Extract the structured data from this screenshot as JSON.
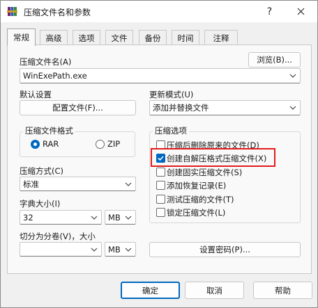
{
  "window": {
    "title": "压缩文件名和参数",
    "help_glyph": "?",
    "close_glyph": "✕"
  },
  "tabs": [
    "常规",
    "高级",
    "选项",
    "文件",
    "备份",
    "时间",
    "注释"
  ],
  "archive_name": {
    "label": "压缩文件名(A)",
    "value": "WinExePath.exe",
    "browse_label": "浏览(B)..."
  },
  "default_settings": {
    "label": "默认设置",
    "profiles_button": "配置文件(F)..."
  },
  "update_mode": {
    "label": "更新模式(U)",
    "value": "添加并替换文件"
  },
  "archive_format": {
    "label": "压缩文件格式",
    "options": [
      "RAR",
      "ZIP"
    ],
    "selected": "RAR"
  },
  "compression_method": {
    "label": "压缩方式(C)",
    "value": "标准"
  },
  "dictionary_size": {
    "label": "字典大小(I)",
    "value": "32",
    "unit": "MB"
  },
  "split_volumes": {
    "label": "切分为分卷(V)，大小",
    "value": "",
    "unit": "MB"
  },
  "archiving_options": {
    "label": "压缩选项",
    "items": [
      {
        "label": "压缩后删除原来的文件(D)",
        "checked": false
      },
      {
        "label": "创建自解压格式压缩文件(X)",
        "checked": true
      },
      {
        "label": "创建固实压缩文件(S)",
        "checked": false
      },
      {
        "label": "添加恢复记录(E)",
        "checked": false
      },
      {
        "label": "测试压缩的文件(T)",
        "checked": false
      },
      {
        "label": "锁定压缩文件(L)",
        "checked": false
      }
    ]
  },
  "set_password_button": "设置密码(P)...",
  "footer": {
    "ok": "确定",
    "cancel": "取消",
    "help": "帮助"
  },
  "colors": {
    "accent": "#0067c0",
    "highlight": "#e01b1b"
  }
}
